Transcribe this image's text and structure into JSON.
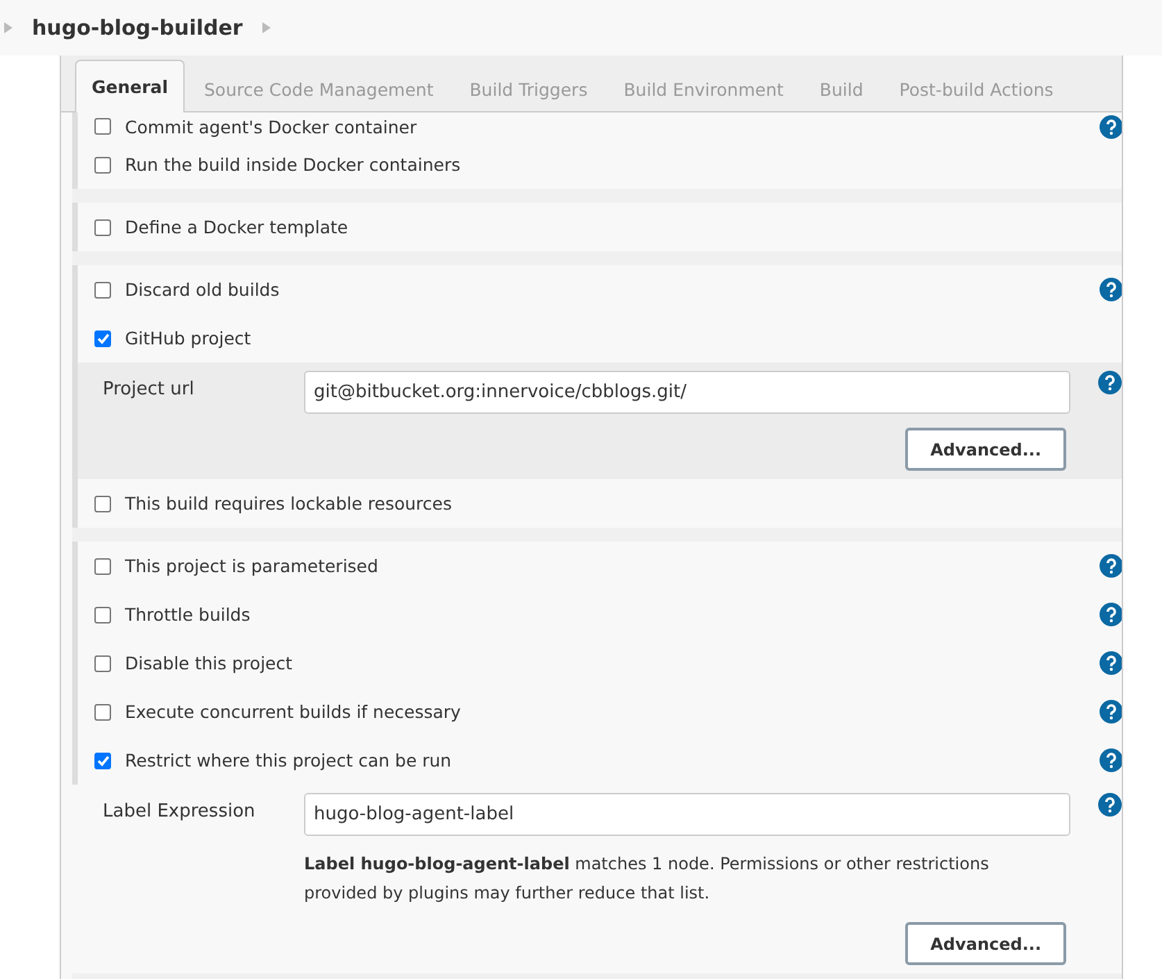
{
  "breadcrumb": {
    "title": "hugo-blog-builder"
  },
  "tabs": [
    {
      "label": "General",
      "selected": true
    },
    {
      "label": "Source Code Management",
      "selected": false
    },
    {
      "label": "Build Triggers",
      "selected": false
    },
    {
      "label": "Build Environment",
      "selected": false
    },
    {
      "label": "Build",
      "selected": false
    },
    {
      "label": "Post-build Actions",
      "selected": false
    }
  ],
  "sections": [
    {
      "items": [
        {
          "label": "Commit agent's Docker container",
          "checked": false,
          "help": true
        },
        {
          "label": "Run the build inside Docker containers",
          "checked": false,
          "help": false
        }
      ]
    },
    {
      "items": [
        {
          "label": "Define a Docker template",
          "checked": false,
          "help": false
        }
      ]
    },
    {
      "items": [
        {
          "label": "Discard old builds",
          "checked": false,
          "help": true
        },
        {
          "label": "GitHub project",
          "checked": true,
          "help": false,
          "details": {
            "shaded": true,
            "field": {
              "label": "Project url",
              "value": "git@bitbucket.org:innervoice/cbblogs.git/"
            },
            "button": "Advanced..."
          }
        },
        {
          "label": "This build requires lockable resources",
          "checked": false,
          "help": false
        }
      ]
    },
    {
      "items": [
        {
          "label": "This project is parameterised",
          "checked": false,
          "help": true
        },
        {
          "label": "Throttle builds",
          "checked": false,
          "help": true
        },
        {
          "label": "Disable this project",
          "checked": false,
          "help": true
        },
        {
          "label": "Execute concurrent builds if necessary",
          "checked": false,
          "help": true
        },
        {
          "label": "Restrict where this project can be run",
          "checked": true,
          "help": true,
          "details": {
            "shaded": false,
            "field": {
              "label": "Label Expression",
              "value": "hugo-blog-agent-label"
            },
            "note": "**Label hugo-blog-agent-label** matches 1 node. Permissions or other restrictions provided by plugins may further reduce that list.",
            "button": "Advanced..."
          }
        }
      ]
    }
  ]
}
